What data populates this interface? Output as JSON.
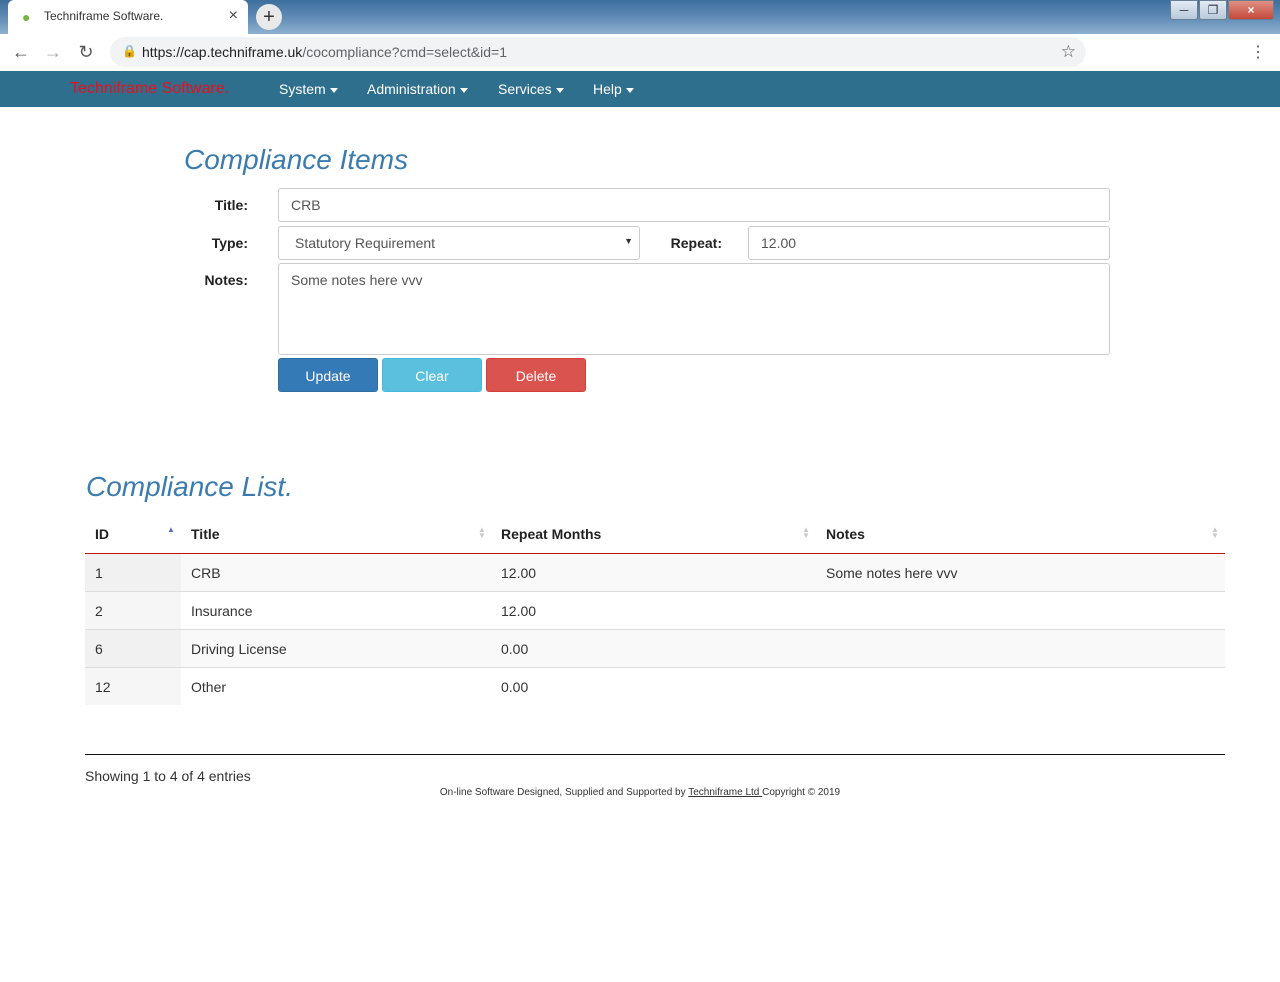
{
  "browser": {
    "tab_title": "Techniframe Software.",
    "new_tab_symbol": "+",
    "url_host": "https://cap.techniframe.uk",
    "url_path": "/cocompliance?cmd=select&id=1",
    "window_controls": [
      "minimize-icon",
      "restore-icon",
      "close-icon"
    ]
  },
  "navbar": {
    "brand": "Techniframe Software.",
    "brand_color": "#e8101a",
    "bg_color": "#2f6f8e",
    "menus": [
      "System",
      "Administration",
      "Services",
      "Help"
    ]
  },
  "form": {
    "heading": "Compliance Items",
    "title_label": "Title:",
    "title_value": "CRB",
    "type_label": "Type:",
    "type_value": "Statutory Requirement",
    "repeat_label": "Repeat:",
    "repeat_value": "12.00",
    "notes_label": "Notes:",
    "notes_value": "Some notes here vvv",
    "buttons": {
      "update": "Update",
      "clear": "Clear",
      "delete": "Delete"
    }
  },
  "list": {
    "heading": "Compliance List.",
    "columns": [
      "ID",
      "Title",
      "Repeat Months",
      "Notes"
    ],
    "sorted_column": "ID",
    "rows": [
      {
        "id": "1",
        "title": "CRB",
        "repeat": "12.00",
        "notes": "Some notes here vvv"
      },
      {
        "id": "2",
        "title": "Insurance",
        "repeat": "12.00",
        "notes": ""
      },
      {
        "id": "6",
        "title": "Driving License",
        "repeat": "0.00",
        "notes": ""
      },
      {
        "id": "12",
        "title": "Other",
        "repeat": "0.00",
        "notes": ""
      }
    ],
    "info": "Showing 1 to 4 of 4 entries"
  },
  "footer": {
    "prefix": "On-line Software Designed, Supplied and Supported by ",
    "link": "Techniframe Ltd ",
    "suffix": "Copyright © 2019"
  }
}
